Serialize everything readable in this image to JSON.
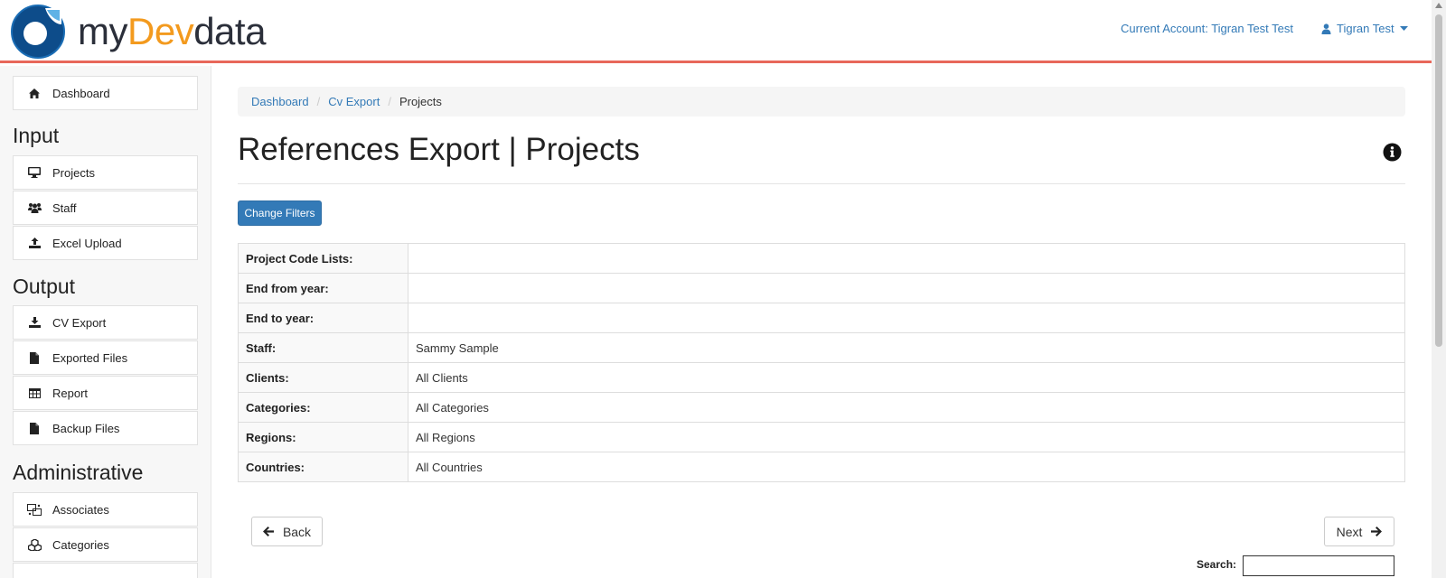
{
  "brand": {
    "my": "my",
    "dev": "Dev",
    "data": "data",
    "accent": "#f39a1e",
    "logo_color": "#0d4c8a"
  },
  "header": {
    "account_label": "Current Account: Tigran Test Test",
    "user_name": "Tigran Test",
    "user_icon": "user-icon",
    "caret_icon": "caret-down-icon",
    "link_color": "#337ab7",
    "border_color": "#e8675a"
  },
  "sidebar": {
    "dashboard": {
      "label": "Dashboard",
      "icon": "home-icon"
    },
    "input_heading": "Input",
    "input_items": [
      {
        "label": "Projects",
        "icon": "desktop-icon"
      },
      {
        "label": "Staff",
        "icon": "users-icon"
      },
      {
        "label": "Excel Upload",
        "icon": "upload-icon"
      }
    ],
    "output_heading": "Output",
    "output_items": [
      {
        "label": "CV Export",
        "icon": "download-icon"
      },
      {
        "label": "Exported Files",
        "icon": "file-icon"
      },
      {
        "label": "Report",
        "icon": "table-icon"
      },
      {
        "label": "Backup Files",
        "icon": "file-icon"
      }
    ],
    "admin_heading": "Administrative",
    "admin_items": [
      {
        "label": "Associates",
        "icon": "associates-icon"
      },
      {
        "label": "Categories",
        "icon": "cubes-icon"
      }
    ]
  },
  "breadcrumb": {
    "items": [
      "Dashboard",
      "Cv Export"
    ],
    "current": "Projects",
    "separator": "/"
  },
  "page": {
    "title": "References Export | Projects",
    "info_icon": "info-circle-icon",
    "change_filters_label": "Change Filters",
    "primary_color": "#337ab7"
  },
  "filters": [
    {
      "label": "Project Code Lists:",
      "value": ""
    },
    {
      "label": "End from year:",
      "value": ""
    },
    {
      "label": "End to year:",
      "value": ""
    },
    {
      "label": "Staff:",
      "value": "Sammy Sample"
    },
    {
      "label": "Clients:",
      "value": "All Clients"
    },
    {
      "label": "Categories:",
      "value": "All Categories"
    },
    {
      "label": "Regions:",
      "value": "All Regions"
    },
    {
      "label": "Countries:",
      "value": "All Countries"
    }
  ],
  "nav": {
    "back_label": "Back",
    "next_label": "Next",
    "back_icon": "arrow-left-icon",
    "next_icon": "arrow-right-icon"
  },
  "search": {
    "label": "Search:",
    "value": ""
  }
}
